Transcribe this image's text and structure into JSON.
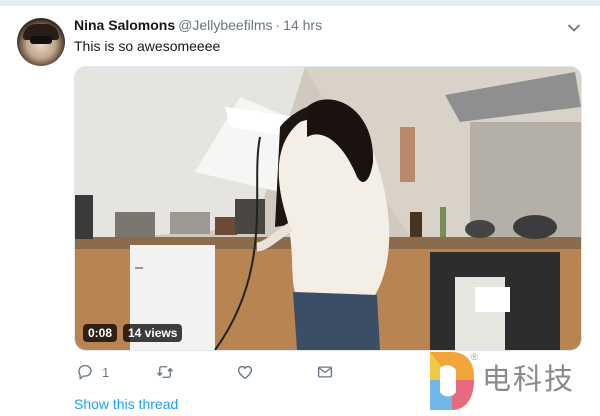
{
  "tweet": {
    "name": "Nina Salomons",
    "handle": "@Jellybeefilms",
    "separator": "·",
    "time": "14 hrs",
    "text": "This is so awesomeeee"
  },
  "video": {
    "duration": "0:08",
    "views": "14 views"
  },
  "actions": {
    "reply_count": "1",
    "retweet_count": "",
    "like_count": "",
    "icons": [
      "reply-icon",
      "retweet-icon",
      "like-icon",
      "direct-message-icon"
    ]
  },
  "show_thread": "Show this thread",
  "watermark": {
    "text": "电科技",
    "mark": "®"
  },
  "colors": {
    "accent": "#1da1f2",
    "secondary_text": "#657786"
  }
}
